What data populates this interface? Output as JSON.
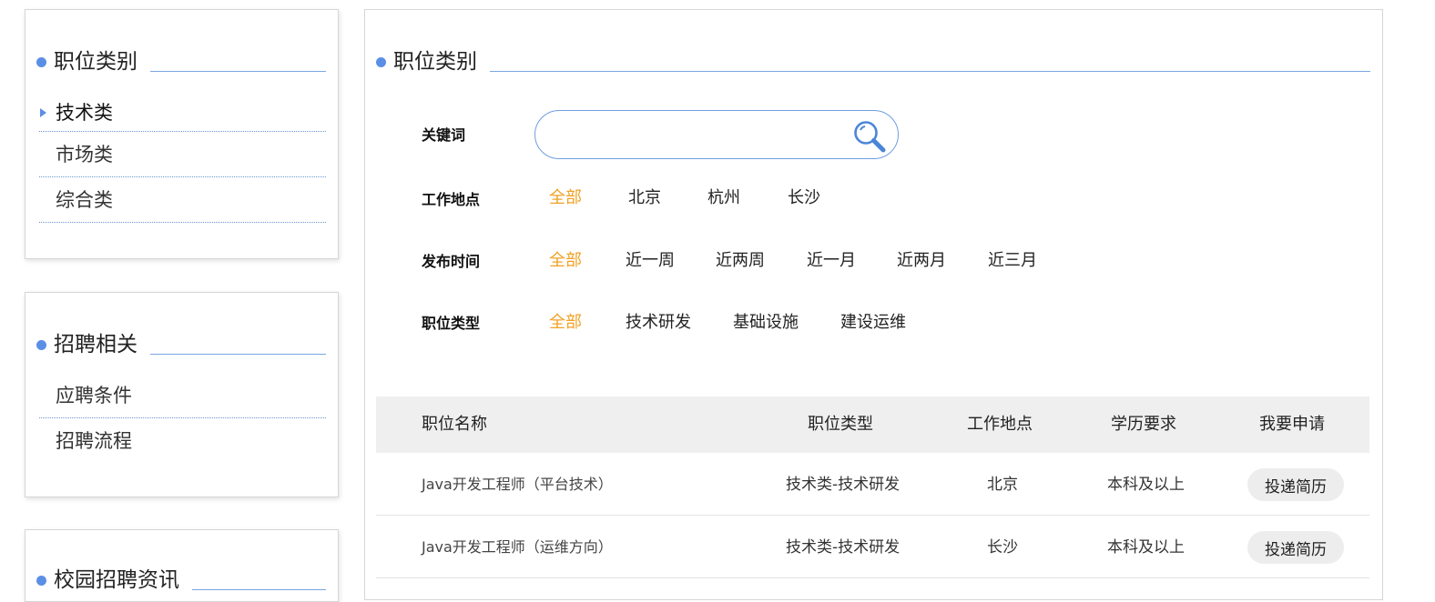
{
  "sidebar": {
    "job_category": {
      "title": "职位类别",
      "items": [
        {
          "label": "技术类",
          "active": true
        },
        {
          "label": "市场类"
        },
        {
          "label": "综合类"
        }
      ]
    },
    "recruit_related": {
      "title": "招聘相关",
      "items": [
        {
          "label": "应聘条件"
        },
        {
          "label": "招聘流程"
        }
      ]
    },
    "campus_info": {
      "title": "校园招聘资讯"
    }
  },
  "main": {
    "title": "职位类别",
    "filters": {
      "keyword": {
        "label": "关键词",
        "value": "",
        "placeholder": ""
      },
      "location": {
        "label": "工作地点",
        "options": [
          "全部",
          "北京",
          "杭州",
          "长沙"
        ],
        "selected": "全部"
      },
      "publish_time": {
        "label": "发布时间",
        "options": [
          "全部",
          "近一周",
          "近两周",
          "近一月",
          "近两月",
          "近三月"
        ],
        "selected": "全部"
      },
      "job_type": {
        "label": "职位类型",
        "options": [
          "全部",
          "技术研发",
          "基础设施",
          "建设运维"
        ],
        "selected": "全部"
      }
    },
    "table": {
      "headers": [
        "职位名称",
        "职位类型",
        "工作地点",
        "学历要求",
        "我要申请"
      ],
      "rows": [
        {
          "name": "Java开发工程师（平台技术）",
          "type": "技术类-技术研发",
          "location": "北京",
          "education": "本科及以上",
          "action": "投递简历"
        },
        {
          "name": "Java开发工程师（运维方向）",
          "type": "技术类-技术研发",
          "location": "长沙",
          "education": "本科及以上",
          "action": "投递简历"
        }
      ]
    }
  },
  "colors": {
    "accent": "#5b8fe6",
    "selected": "#f0a125",
    "header_bg": "#efefef"
  }
}
